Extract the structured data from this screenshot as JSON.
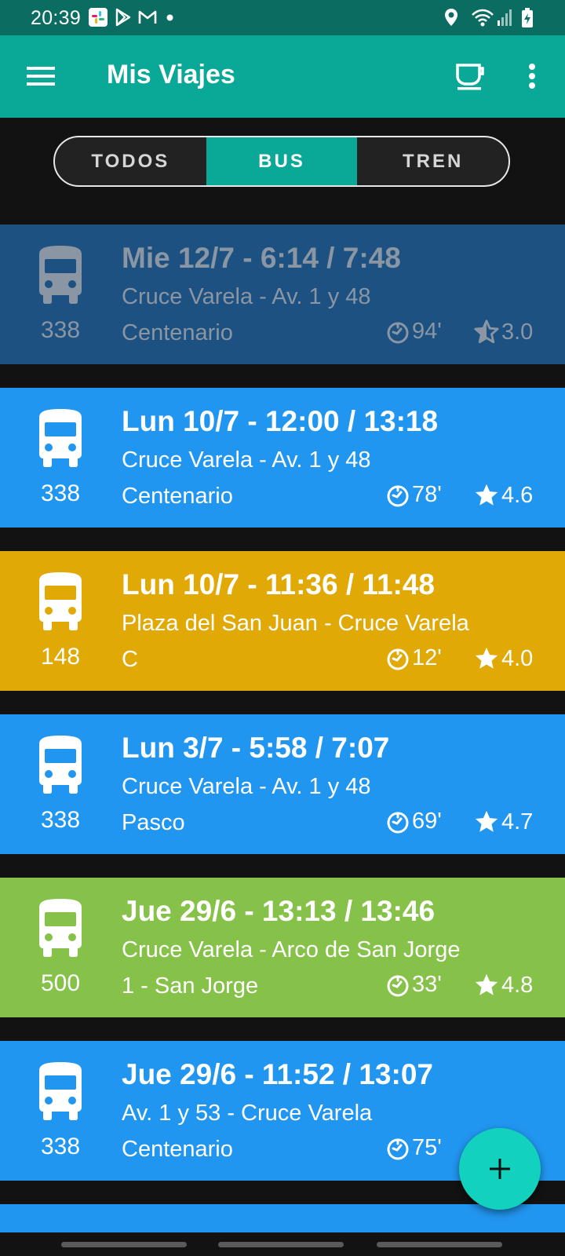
{
  "status_bar": {
    "time": "20:39",
    "icons": [
      "slack-icon",
      "play-store-icon",
      "gmail-icon",
      "dot-icon",
      "location-icon",
      "wifi-icon",
      "signal-icon",
      "battery-charging-icon"
    ]
  },
  "app_bar": {
    "title": "Mis Viajes",
    "menu_icon": "hamburger-menu-icon",
    "coffee_icon": "coffee-cup-icon",
    "overflow_icon": "more-vertical-icon"
  },
  "tabs": [
    {
      "label": "TODOS",
      "active": false
    },
    {
      "label": "BUS",
      "active": true
    },
    {
      "label": "TREN",
      "active": false
    }
  ],
  "colors": {
    "status_bar": "#0b6d62",
    "app_bar": "#0aa896",
    "accent": "#12d2bd",
    "card_blue": "#2196f0",
    "card_dim_blue": "#1c5181",
    "card_yellow": "#e0a906",
    "card_green": "#86c24a"
  },
  "trips": [
    {
      "route": "338",
      "when": "Mie 12/7 - 6:14 / 7:48",
      "stops": "Cruce Varela - Av. 1 y 48",
      "line": "Centenario",
      "duration": "94'",
      "rating": "3.0",
      "color": "#1c5181",
      "dim": true
    },
    {
      "route": "338",
      "when": "Lun 10/7 - 12:00 / 13:18",
      "stops": "Cruce Varela - Av. 1 y 48",
      "line": "Centenario",
      "duration": "78'",
      "rating": "4.6",
      "color": "#2196f0",
      "dim": false
    },
    {
      "route": "148",
      "when": "Lun 10/7 - 11:36 / 11:48",
      "stops": "Plaza del San Juan - Cruce Varela",
      "line": "C",
      "duration": "12'",
      "rating": "4.0",
      "color": "#e0a906",
      "dim": false
    },
    {
      "route": "338",
      "when": "Lun 3/7 - 5:58 / 7:07",
      "stops": "Cruce Varela - Av. 1 y 48",
      "line": "Pasco",
      "duration": "69'",
      "rating": "4.7",
      "color": "#2196f0",
      "dim": false
    },
    {
      "route": "500",
      "when": "Jue 29/6 - 13:13 / 13:46",
      "stops": "Cruce Varela - Arco de San Jorge",
      "line": "1 - San Jorge",
      "duration": "33'",
      "rating": "4.8",
      "color": "#86c24a",
      "dim": false
    },
    {
      "route": "338",
      "when": "Jue 29/6 - 11:52 / 13:07",
      "stops": "Av. 1 y 53 - Cruce Varela",
      "line": "Centenario",
      "duration": "75'",
      "rating": "",
      "color": "#2196f0",
      "dim": false
    }
  ],
  "fab": {
    "label": "+",
    "icon": "add-icon"
  }
}
